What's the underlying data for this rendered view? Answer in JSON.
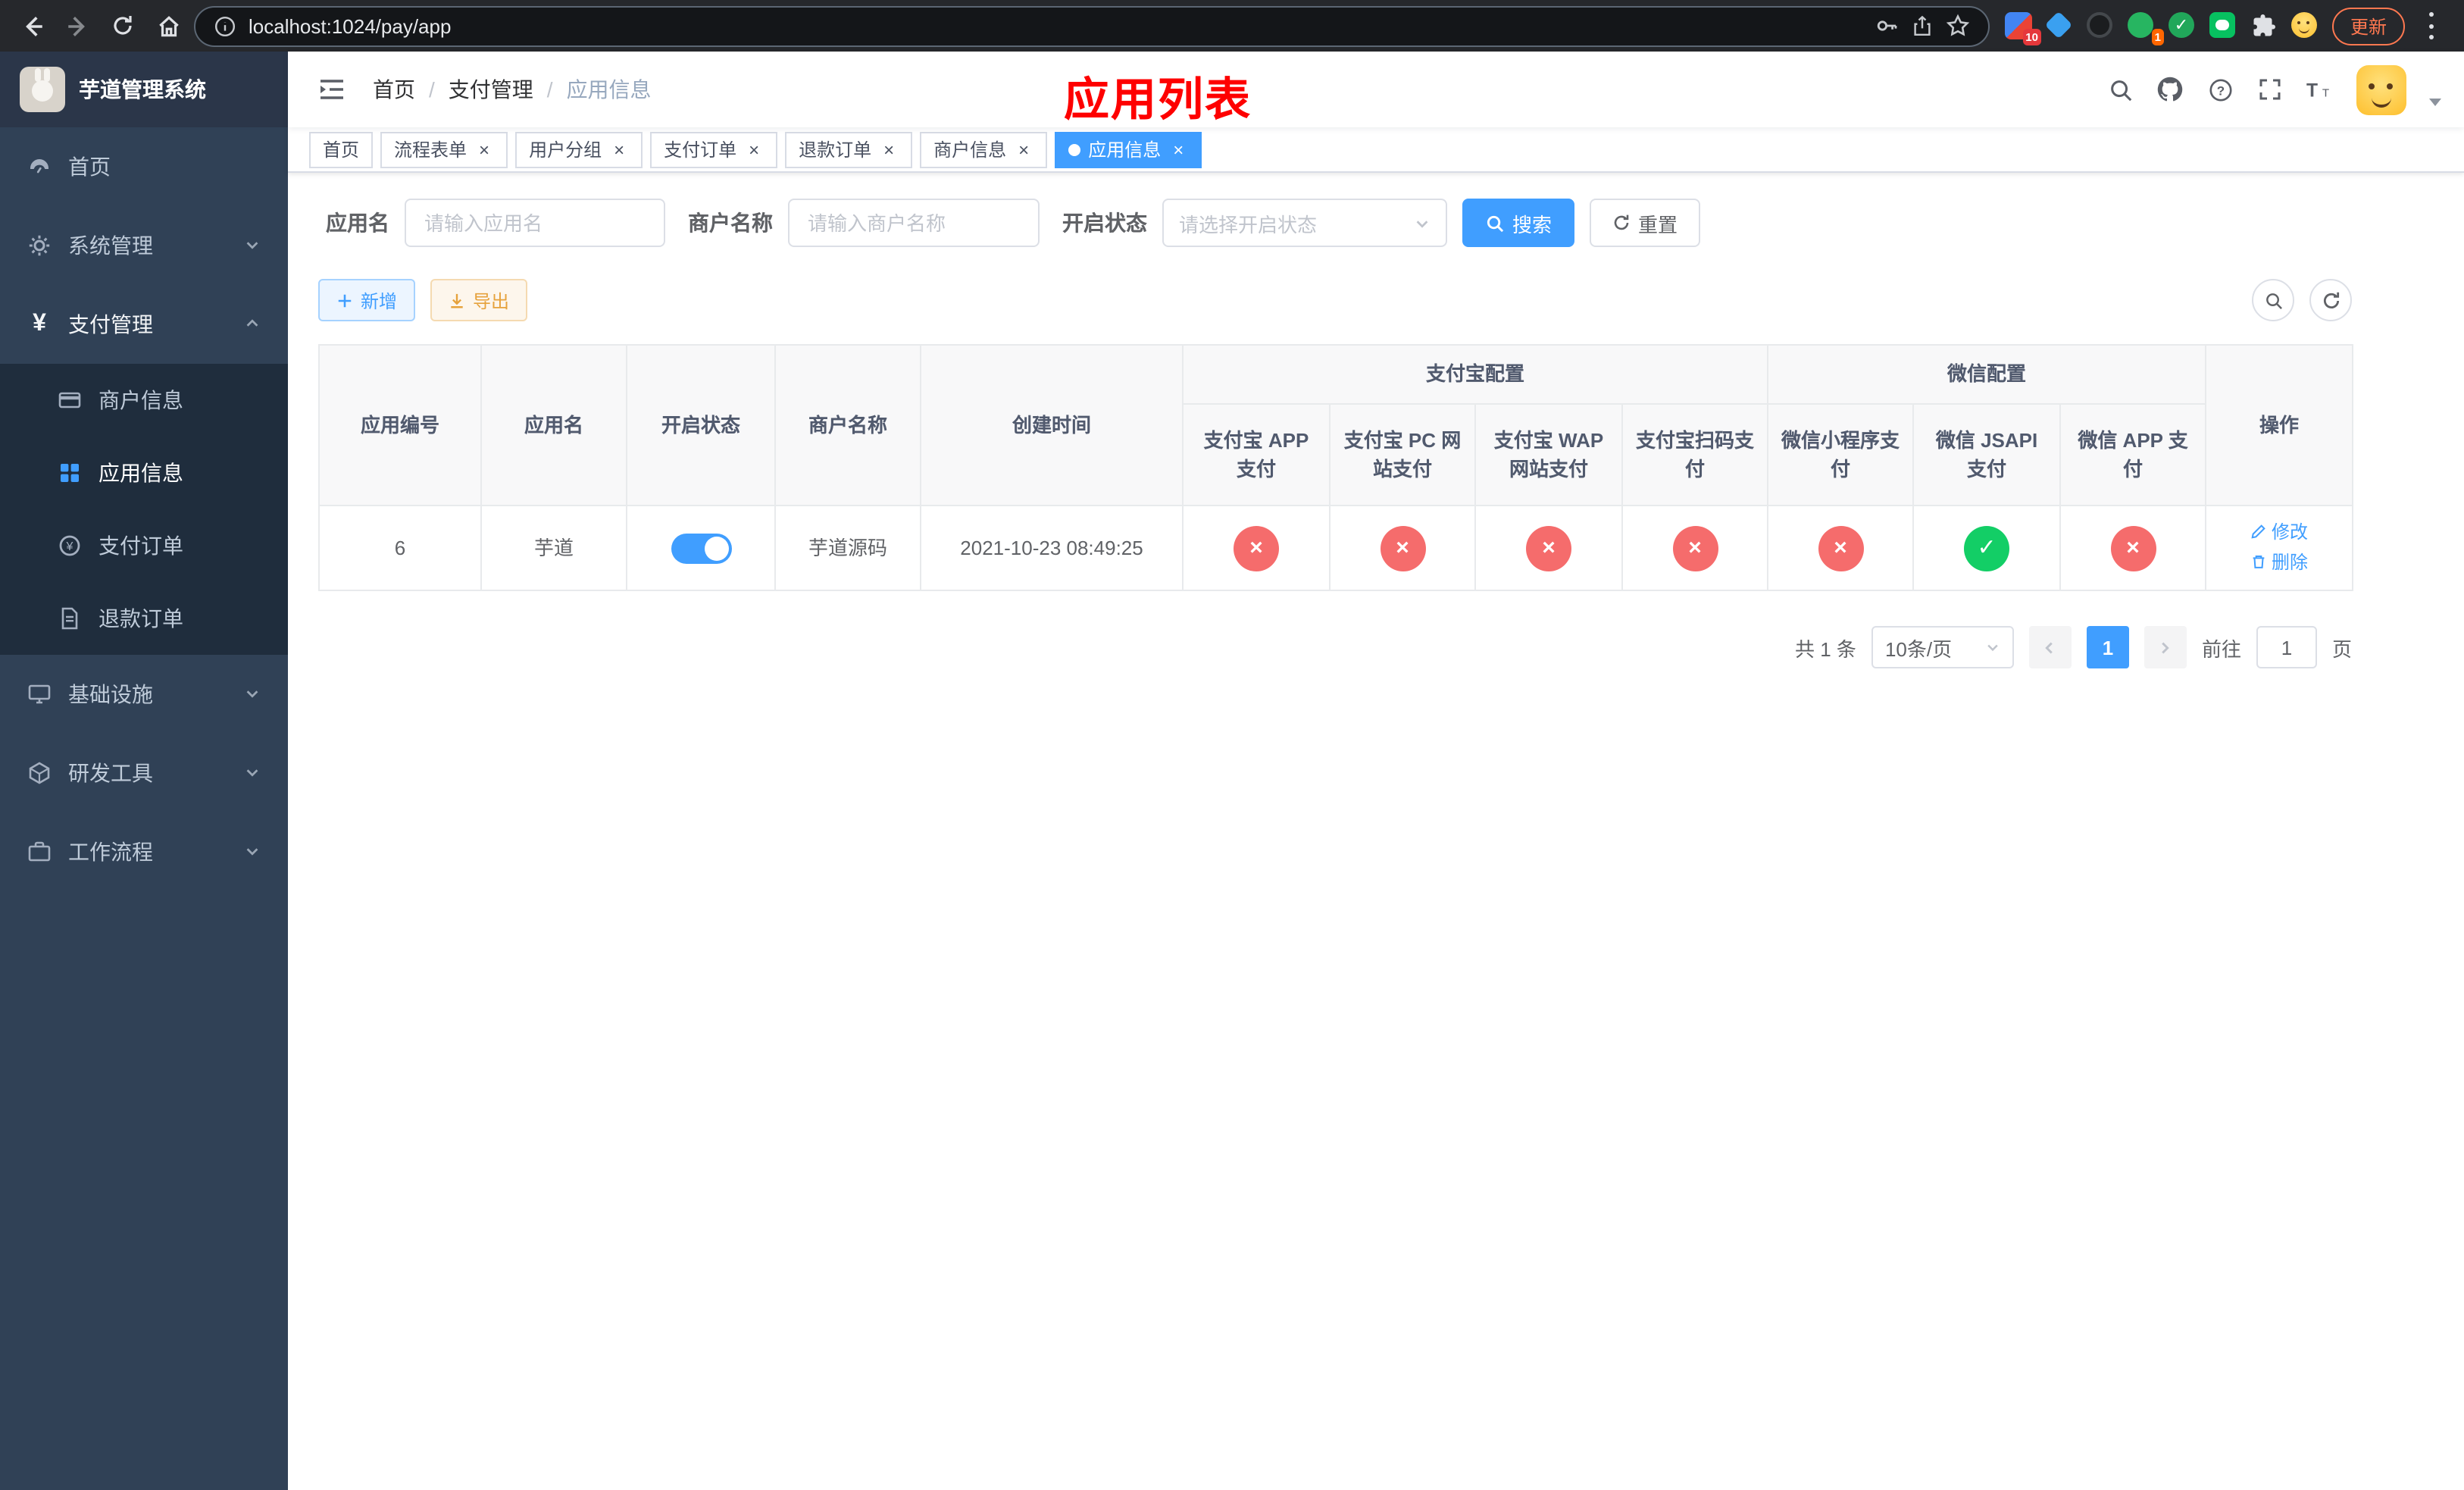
{
  "browser": {
    "url": "localhost:1024/pay/app",
    "update_label": "更新",
    "extension_badge": "10",
    "profile_badge": "1"
  },
  "colors": {
    "primary": "#409eff",
    "danger": "#f56c6c",
    "success": "#13ce66",
    "warning": "#e6a23c",
    "banner": "#fe0000",
    "sidebar_bg": "#304156"
  },
  "sidebar": {
    "logo_title": "芋道管理系统",
    "top_items": [
      {
        "label": "首页"
      },
      {
        "label": "系统管理"
      },
      {
        "label": "支付管理"
      }
    ],
    "payment_children": [
      {
        "label": "商户信息",
        "active": false
      },
      {
        "label": "应用信息",
        "active": true
      },
      {
        "label": "支付订单",
        "active": false
      },
      {
        "label": "退款订单",
        "active": false
      }
    ],
    "bottom_items": [
      {
        "label": "基础设施"
      },
      {
        "label": "研发工具"
      },
      {
        "label": "工作流程"
      }
    ]
  },
  "header": {
    "breadcrumb": [
      "首页",
      "支付管理",
      "应用信息"
    ],
    "banner": "应用列表"
  },
  "tabs": [
    {
      "label": "首页",
      "closable": false,
      "active": false
    },
    {
      "label": "流程表单",
      "closable": true,
      "active": false
    },
    {
      "label": "用户分组",
      "closable": true,
      "active": false
    },
    {
      "label": "支付订单",
      "closable": true,
      "active": false
    },
    {
      "label": "退款订单",
      "closable": true,
      "active": false
    },
    {
      "label": "商户信息",
      "closable": true,
      "active": false
    },
    {
      "label": "应用信息",
      "closable": true,
      "active": true
    }
  ],
  "filters": {
    "app_name_label": "应用名",
    "app_name_placeholder": "请输入应用名",
    "merchant_label": "商户名称",
    "merchant_placeholder": "请输入商户名称",
    "status_label": "开启状态",
    "status_placeholder": "请选择开启状态",
    "search_label": "搜索",
    "reset_label": "重置"
  },
  "toolbar": {
    "add_label": "新增",
    "export_label": "导出"
  },
  "table": {
    "headers": {
      "app_id": "应用编号",
      "app_name": "应用名",
      "status": "开启状态",
      "merchant_name": "商户名称",
      "create_time": "创建时间",
      "alipay_group": "支付宝配置",
      "wechat_group": "微信配置",
      "actions": "操作",
      "sub": [
        "支付宝 APP 支付",
        "支付宝 PC 网站支付",
        "支付宝 WAP 网站支付",
        "支付宝扫码支付",
        "微信小程序支付",
        "微信 JSAPI 支付",
        "微信 APP 支付"
      ]
    },
    "rows": [
      {
        "app_id": "6",
        "app_name": "芋道",
        "status_on": true,
        "merchant_name": "芋道源码",
        "create_time": "2021-10-23 08:49:25",
        "configs": [
          false,
          false,
          false,
          false,
          false,
          true,
          false
        ],
        "edit_label": "修改",
        "delete_label": "删除"
      }
    ]
  },
  "pagination": {
    "total": "共 1 条",
    "page_size": "10条/页",
    "current_page": "1",
    "goto_label": "前往",
    "goto_value": "1",
    "page_unit": "页"
  }
}
